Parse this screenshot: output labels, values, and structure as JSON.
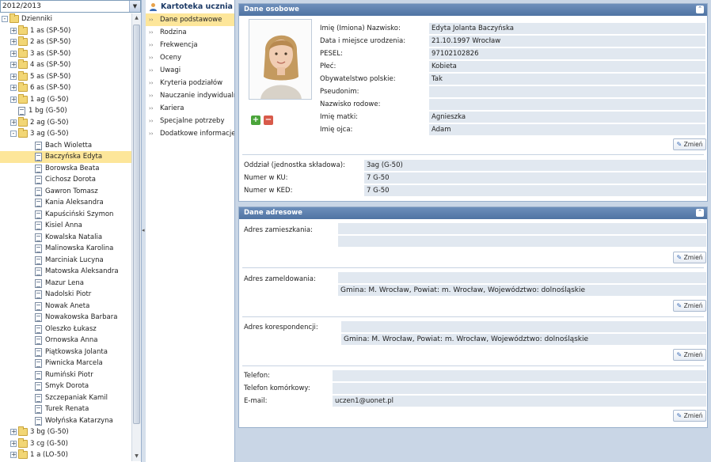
{
  "year_select": {
    "value": "2012/2013"
  },
  "tree": {
    "rows": [
      {
        "label": "Dzienniki",
        "indent": 0,
        "kind": "folder-open",
        "exp": "-"
      },
      {
        "label": "1 as (SP-50)",
        "indent": 1,
        "kind": "folder",
        "exp": "+"
      },
      {
        "label": "2 as (SP-50)",
        "indent": 1,
        "kind": "folder",
        "exp": "+"
      },
      {
        "label": "3 as (SP-50)",
        "indent": 1,
        "kind": "folder",
        "exp": "+"
      },
      {
        "label": "4 as (SP-50)",
        "indent": 1,
        "kind": "folder",
        "exp": "+"
      },
      {
        "label": "5 as (SP-50)",
        "indent": 1,
        "kind": "folder",
        "exp": "+"
      },
      {
        "label": "6 as (SP-50)",
        "indent": 1,
        "kind": "folder",
        "exp": "+"
      },
      {
        "label": "1 ag (G-50)",
        "indent": 1,
        "kind": "folder",
        "exp": "+"
      },
      {
        "label": "1 bg (G-50)",
        "indent": 1,
        "kind": "doc",
        "exp": ""
      },
      {
        "label": "2 ag (G-50)",
        "indent": 1,
        "kind": "folder",
        "exp": "+"
      },
      {
        "label": "3 ag (G-50)",
        "indent": 1,
        "kind": "folder-open",
        "exp": "-"
      },
      {
        "label": "Bach Wioletta",
        "indent": 2,
        "kind": "doc",
        "exp": ""
      },
      {
        "label": "Baczyńska Edyta",
        "indent": 2,
        "kind": "doc",
        "exp": "",
        "selected": true
      },
      {
        "label": "Borowska Beata",
        "indent": 2,
        "kind": "doc",
        "exp": ""
      },
      {
        "label": "Cichosz Dorota",
        "indent": 2,
        "kind": "doc",
        "exp": ""
      },
      {
        "label": "Gawron Tomasz",
        "indent": 2,
        "kind": "doc",
        "exp": ""
      },
      {
        "label": "Kania Aleksandra",
        "indent": 2,
        "kind": "doc",
        "exp": ""
      },
      {
        "label": "Kapuściński Szymon",
        "indent": 2,
        "kind": "doc",
        "exp": ""
      },
      {
        "label": "Kisiel Anna",
        "indent": 2,
        "kind": "doc",
        "exp": ""
      },
      {
        "label": "Kowalska Natalia",
        "indent": 2,
        "kind": "doc",
        "exp": ""
      },
      {
        "label": "Malinowska Karolina",
        "indent": 2,
        "kind": "doc",
        "exp": ""
      },
      {
        "label": "Marciniak Lucyna",
        "indent": 2,
        "kind": "doc",
        "exp": ""
      },
      {
        "label": "Matowska Aleksandra",
        "indent": 2,
        "kind": "doc",
        "exp": ""
      },
      {
        "label": "Mazur Lena",
        "indent": 2,
        "kind": "doc",
        "exp": ""
      },
      {
        "label": "Nadolski Piotr",
        "indent": 2,
        "kind": "doc",
        "exp": ""
      },
      {
        "label": "Nowak Aneta",
        "indent": 2,
        "kind": "doc",
        "exp": ""
      },
      {
        "label": "Nowakowska Barbara",
        "indent": 2,
        "kind": "doc",
        "exp": ""
      },
      {
        "label": "Oleszko Łukasz",
        "indent": 2,
        "kind": "doc",
        "exp": ""
      },
      {
        "label": "Ornowska Anna",
        "indent": 2,
        "kind": "doc",
        "exp": ""
      },
      {
        "label": "Piątkowska Jolanta",
        "indent": 2,
        "kind": "doc",
        "exp": ""
      },
      {
        "label": "Piwnicka Marcela",
        "indent": 2,
        "kind": "doc",
        "exp": ""
      },
      {
        "label": "Rumiński Piotr",
        "indent": 2,
        "kind": "doc",
        "exp": ""
      },
      {
        "label": "Smyk Dorota",
        "indent": 2,
        "kind": "doc",
        "exp": ""
      },
      {
        "label": "Szczepaniak Kamil",
        "indent": 2,
        "kind": "doc",
        "exp": ""
      },
      {
        "label": "Turek Renata",
        "indent": 2,
        "kind": "doc",
        "exp": ""
      },
      {
        "label": "Wołyńska Katarzyna",
        "indent": 2,
        "kind": "doc",
        "exp": ""
      },
      {
        "label": "3 bg (G-50)",
        "indent": 1,
        "kind": "folder",
        "exp": "+"
      },
      {
        "label": "3 cg (G-50)",
        "indent": 1,
        "kind": "folder",
        "exp": "+"
      },
      {
        "label": "1 a (LO-50)",
        "indent": 1,
        "kind": "folder",
        "exp": "+"
      }
    ]
  },
  "menu": {
    "title": "Kartoteka ucznia",
    "items": [
      {
        "label": "Dane podstawowe",
        "active": true
      },
      {
        "label": "Rodzina"
      },
      {
        "label": "Frekwencja"
      },
      {
        "label": "Oceny"
      },
      {
        "label": "Uwagi"
      },
      {
        "label": "Kryteria podziałów"
      },
      {
        "label": "Nauczanie indywidualne"
      },
      {
        "label": "Kariera"
      },
      {
        "label": "Specjalne potrzeby"
      },
      {
        "label": "Dodatkowe informacje"
      }
    ]
  },
  "personal": {
    "header": "Dane osobowe",
    "fields": [
      {
        "label": "Imię (Imiona) Nazwisko:",
        "value": "Edyta Jolanta Baczyńska"
      },
      {
        "label": "Data i miejsce urodzenia:",
        "value": "21.10.1997 Wrocław"
      },
      {
        "label": "PESEL:",
        "value": "97102102826"
      },
      {
        "label": "Płeć:",
        "value": "Kobieta"
      },
      {
        "label": "Obywatelstwo polskie:",
        "value": "Tak"
      },
      {
        "label": "Pseudonim:",
        "value": ""
      },
      {
        "label": "Nazwisko rodowe:",
        "value": ""
      },
      {
        "label": "Imię matki:",
        "value": "Agnieszka"
      },
      {
        "label": "Imię ojca:",
        "value": "Adam"
      }
    ],
    "class_fields": [
      {
        "label": "Oddział (jednostka składowa):",
        "value": "3ag (G-50)"
      },
      {
        "label": "Numer w KU:",
        "value": "7 G-50"
      },
      {
        "label": "Numer w KED:",
        "value": "7 G-50"
      }
    ],
    "edit_label": "Zmień"
  },
  "address": {
    "header": "Dane adresowe",
    "residence_label": "Adres zamieszkania:",
    "residence_value": "",
    "registered_label": "Adres zameldowania:",
    "registered_value": "Gmina: M. Wrocław, Powiat: m. Wrocław, Województwo: dolnośląskie",
    "correspondence_label": "Adres korespondencji:",
    "correspondence_value": "Gmina: M. Wrocław, Powiat: m. Wrocław, Województwo: dolnośląskie",
    "phone_label": "Telefon:",
    "phone_value": "",
    "mobile_label": "Telefon komórkowy:",
    "mobile_value": "",
    "email_label": "E-mail:",
    "email_value": "uczen1@uonet.pl",
    "edit_label": "Zmień"
  },
  "colors": {
    "header_blue": "#4f73a3",
    "selection_yellow": "#fde69a",
    "field_bg": "#e1e8f0",
    "background": "#c9d6e6"
  }
}
